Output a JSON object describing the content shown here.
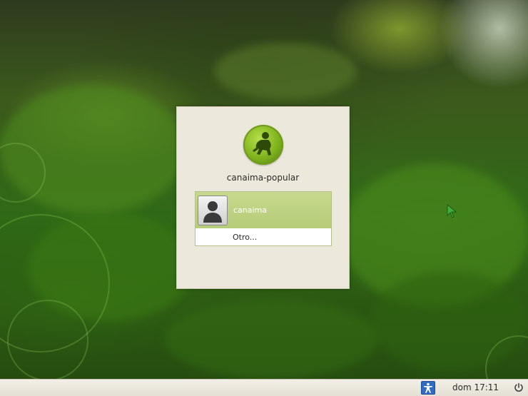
{
  "login": {
    "host_name": "canaima-popular",
    "users": [
      {
        "name": "canaima"
      }
    ],
    "other_label": "Otro..."
  },
  "panel": {
    "clock": "dom 17:11"
  },
  "icons": {
    "distro_logo": "canaima-logo-icon",
    "user_avatar": "user-avatar-icon",
    "accessibility": "accessibility-icon",
    "power": "power-icon",
    "cursor": "mouse-pointer-icon"
  },
  "colors": {
    "dialog_bg": "#ede8dc",
    "selected_row": "#b5cc78",
    "accessibility_blue": "#2f6cc2",
    "panel_bg": "#e4e0d4"
  }
}
